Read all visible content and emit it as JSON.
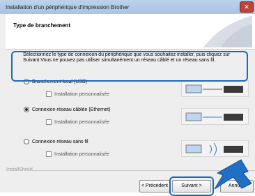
{
  "window": {
    "title": "Installation d'un périphérique d'impression Brother",
    "close_icon": "close-icon"
  },
  "header": {
    "title": "Type de branchement"
  },
  "intro": {
    "text": "Sélectionnez le type de connexion du périphérique que vous souhaitez installer, puis cliquez sur Suivant.Vous ne pouvez pas utiliser simultanément un réseau câblé et un réseau sans fil."
  },
  "options": [
    {
      "label": "Branchement local (USB)",
      "selected": false,
      "sub_option": "Installation personnalisée",
      "device_icon": "usb-connection-icon"
    },
    {
      "label": "Connexion réseau câblée (Ethernet)",
      "selected": true,
      "sub_option": "Installation personnalisée",
      "device_icon": "ethernet-connection-icon"
    },
    {
      "label": "Connexion réseau sans fil",
      "selected": false,
      "sub_option": "Installation personnalisée",
      "device_icon": "wifi-connection-icon"
    }
  ],
  "footer": {
    "brand_text": "InstallShield",
    "back_label": "< Précédent",
    "next_label": "Suivant >",
    "cancel_label": "Annuler"
  },
  "colors": {
    "highlight": "#1e69b8",
    "arrow": "#1f6fc2"
  }
}
